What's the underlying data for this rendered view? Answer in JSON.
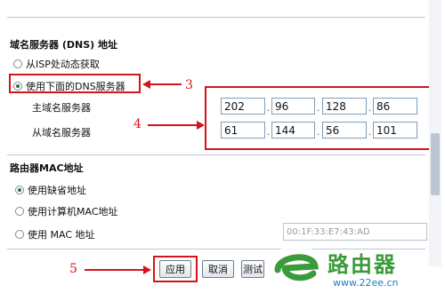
{
  "dns": {
    "section_title": "域名服务器 (DNS) 地址",
    "option_auto": "从ISP处动态获取",
    "option_manual": "使用下面的DNS服务器",
    "selected": "manual",
    "primary_label": "主域名服务器",
    "secondary_label": "从域名服务器",
    "primary": [
      "202",
      "96",
      "128",
      "86"
    ],
    "secondary": [
      "61",
      "144",
      "56",
      "101"
    ]
  },
  "mac": {
    "section_title": "路由器MAC地址",
    "option_default": "使用缺省地址",
    "option_computer": "使用计算机MAC地址",
    "option_custom": "使用  MAC 地址",
    "custom_value": "00:1F:33:E7:43:AD",
    "selected": "default"
  },
  "annotations": {
    "a3": "3",
    "a4": "4",
    "a5": "5"
  },
  "buttons": {
    "apply": "应用",
    "cancel": "取消",
    "test": "测试"
  },
  "watermark": {
    "brand": "路由器",
    "url": "www.22ee.cn",
    "colors": [
      "#3a9b3a",
      "#1a7fc1"
    ]
  }
}
